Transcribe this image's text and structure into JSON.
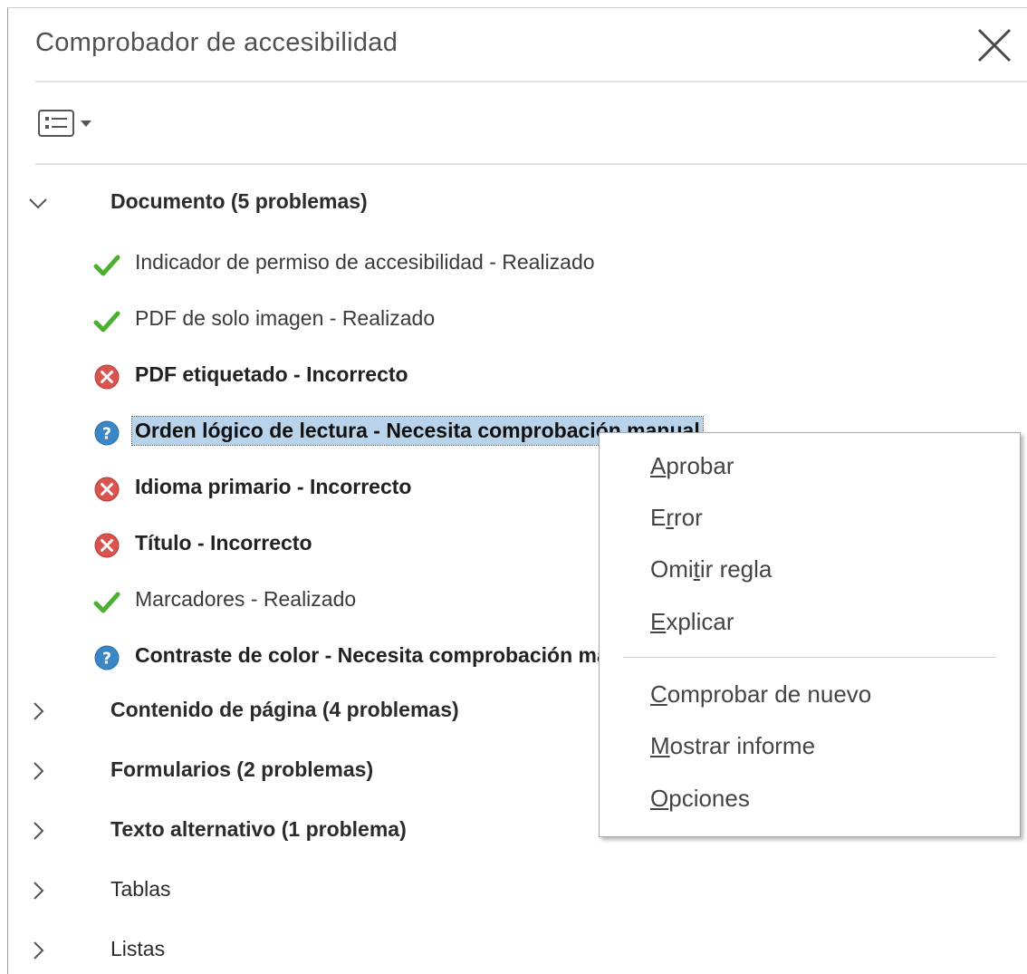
{
  "window": {
    "title": "Comprobador de accesibilidad"
  },
  "icons": {
    "close": "close-icon",
    "options": "list-options-icon",
    "passed": "check-icon",
    "failed": "error-icon",
    "manual": "question-icon",
    "expanded": "chevron-down-icon",
    "collapsed": "chevron-right-icon"
  },
  "colors": {
    "passed": "#4caf2f",
    "failed": "#d9534f",
    "manual": "#3a87c8",
    "selection": "#b9d3ea"
  },
  "tree": {
    "document": {
      "label": "Documento (5 problemas)",
      "items": [
        {
          "label": "Indicador de permiso de accesibilidad - Realizado",
          "status": "passed"
        },
        {
          "label": "PDF de solo imagen - Realizado",
          "status": "passed"
        },
        {
          "label": "PDF etiquetado - Incorrecto",
          "status": "failed"
        },
        {
          "label": "Orden lógico de lectura - Necesita comprobación manual",
          "status": "manual"
        },
        {
          "label": "Idioma primario - Incorrecto",
          "status": "failed"
        },
        {
          "label": "Título - Incorrecto",
          "status": "failed"
        },
        {
          "label": "Marcadores - Realizado",
          "status": "passed"
        },
        {
          "label": "Contraste de color - Necesita comprobación manual",
          "status": "manual"
        }
      ]
    },
    "page_content": {
      "label": "Contenido de página (4 problemas)"
    },
    "forms": {
      "label": "Formularios (2 problemas)"
    },
    "alt_text": {
      "label": "Texto alternativo (1 problema)"
    },
    "tables": {
      "label": "Tablas"
    },
    "lists": {
      "label": "Listas"
    }
  },
  "context_menu": {
    "items": [
      {
        "label": "Aprobar",
        "access_key": "A"
      },
      {
        "label": "Error",
        "access_key": "r"
      },
      {
        "label": "Omitir regla",
        "access_key": "t"
      },
      {
        "label": "Explicar",
        "access_key": "E"
      },
      {
        "label": "Comprobar de nuevo",
        "access_key": "C"
      },
      {
        "label": "Mostrar informe",
        "access_key": "M"
      },
      {
        "label": "Opciones",
        "access_key": "O"
      }
    ]
  }
}
